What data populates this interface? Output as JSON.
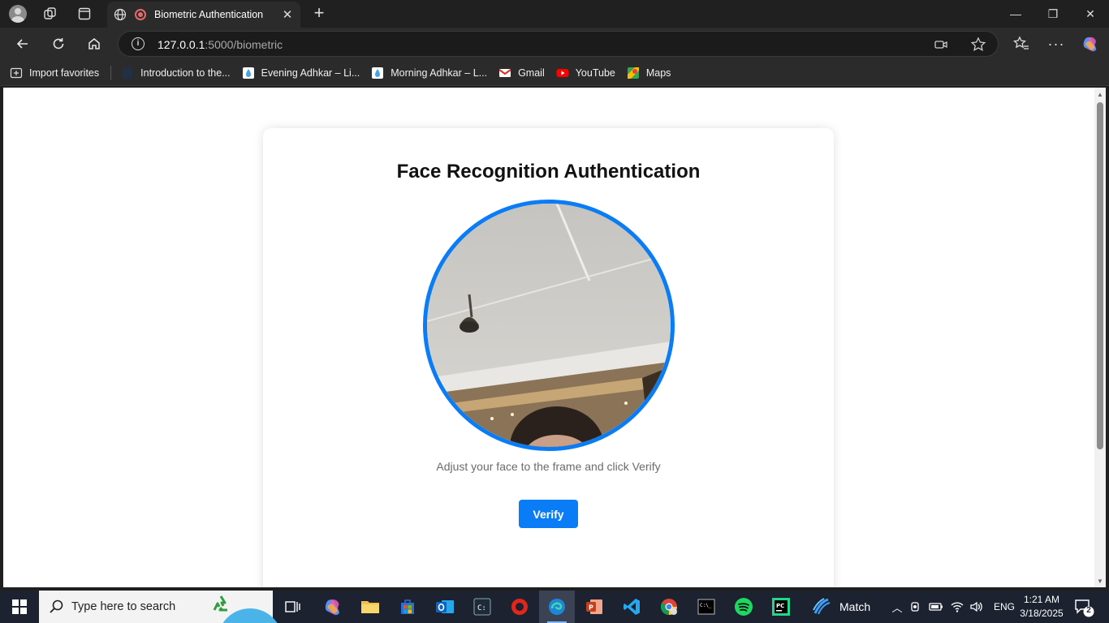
{
  "browser": {
    "tab": {
      "title": "Biometric Authentication"
    },
    "address": {
      "host": "127.0.0.1",
      "path": ":5000/biometric"
    },
    "bookmarks": [
      {
        "label": "Import favorites",
        "icon": "import-icon"
      },
      {
        "label": "Introduction to the...",
        "icon": "page-icon"
      },
      {
        "label": "Evening Adhkar – Li...",
        "icon": "drop-icon"
      },
      {
        "label": "Morning Adhkar – L...",
        "icon": "drop-icon"
      },
      {
        "label": "Gmail",
        "icon": "gmail-icon"
      },
      {
        "label": "YouTube",
        "icon": "youtube-icon"
      },
      {
        "label": "Maps",
        "icon": "maps-icon"
      }
    ]
  },
  "page": {
    "heading": "Face Recognition Authentication",
    "hint": "Adjust your face to the frame and click Verify",
    "verify_label": "Verify",
    "accent": "#0a7cf5"
  },
  "taskbar": {
    "search_placeholder": "Type here to search",
    "weather_label": "Match",
    "language": "ENG",
    "time": "1:21 AM",
    "date": "3/18/2025",
    "notification_count": "2"
  }
}
